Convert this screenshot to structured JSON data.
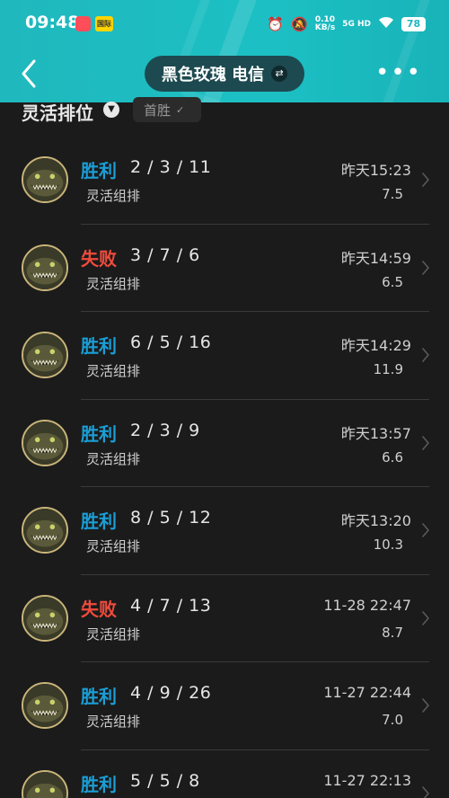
{
  "status_bar": {
    "time": "09:48",
    "app1_icon": "red-app-icon",
    "app2_label": "国际",
    "alarm_icon": "alarm-icon",
    "mute_icon": "bell-off-icon",
    "net_speed": "0.10",
    "net_unit": "KB/s",
    "signal_label": "5G HD",
    "wifi_icon": "wifi-icon",
    "battery": "78"
  },
  "nav": {
    "back_icon": "chevron-left-icon",
    "title": "黑色玫瑰 电信",
    "swap_icon": "swap-icon",
    "more_icon": "more-horizontal-icon",
    "brand_color": "#1fb8bd"
  },
  "filter": {
    "title": "灵活排位",
    "caret_icon": "chevron-down-icon",
    "chip_label": "首胜",
    "chip_icon": "check-icon"
  },
  "matches": [
    {
      "result": "胜利",
      "outcome": "win",
      "kda": "2 / 3 / 11",
      "mode": "灵活组排",
      "date": "昨天15:23",
      "score": "7.5"
    },
    {
      "result": "失败",
      "outcome": "loss",
      "kda": "3 / 7 / 6",
      "mode": "灵活组排",
      "date": "昨天14:59",
      "score": "6.5"
    },
    {
      "result": "胜利",
      "outcome": "win",
      "kda": "6 / 5 / 16",
      "mode": "灵活组排",
      "date": "昨天14:29",
      "score": "11.9"
    },
    {
      "result": "胜利",
      "outcome": "win",
      "kda": "2 / 3 / 9",
      "mode": "灵活组排",
      "date": "昨天13:57",
      "score": "6.6"
    },
    {
      "result": "胜利",
      "outcome": "win",
      "kda": "8 / 5 / 12",
      "mode": "灵活组排",
      "date": "昨天13:20",
      "score": "10.3"
    },
    {
      "result": "失败",
      "outcome": "loss",
      "kda": "4 / 7 / 13",
      "mode": "灵活组排",
      "date": "11-28 22:47",
      "score": "8.7"
    },
    {
      "result": "胜利",
      "outcome": "win",
      "kda": "4 / 9 / 26",
      "mode": "灵活组排",
      "date": "11-27 22:44",
      "score": "7.0"
    },
    {
      "result": "胜利",
      "outcome": "win",
      "kda": "5 / 5 / 8",
      "mode": "灵活组排",
      "date": "11-27 22:13",
      "score": ""
    }
  ],
  "colors": {
    "win": "#1a9ed6",
    "loss": "#ef4b3c",
    "background": "#1b1b1b"
  }
}
